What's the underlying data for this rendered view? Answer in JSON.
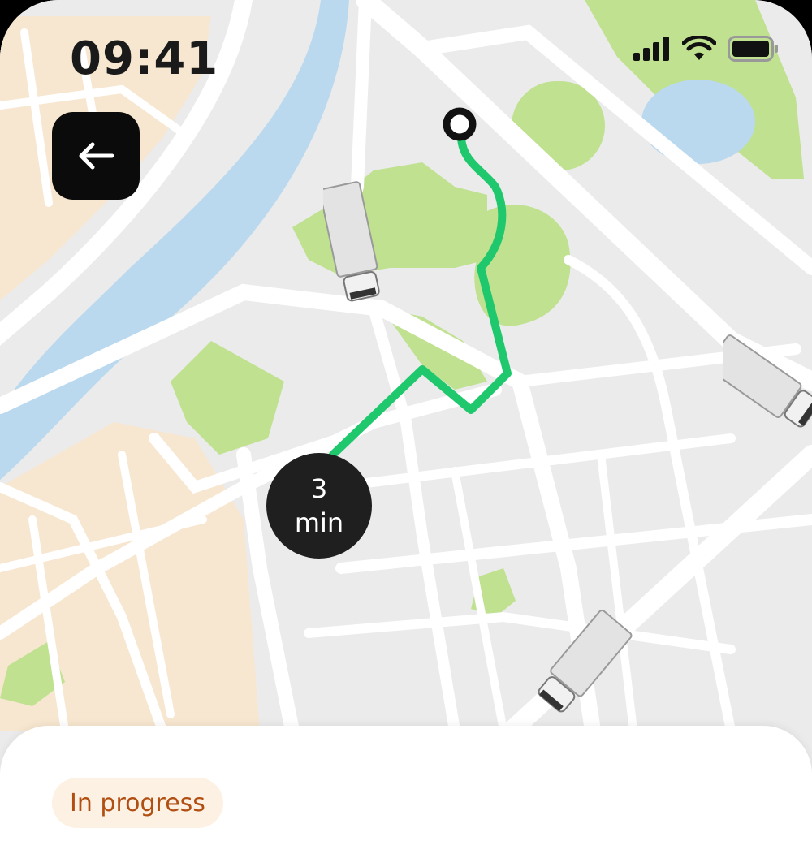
{
  "status_bar": {
    "time": "09:41",
    "icons": [
      "cellular-signal-icon",
      "wifi-icon",
      "battery-icon"
    ]
  },
  "navigation": {
    "back_icon": "arrow-left-icon"
  },
  "map": {
    "eta_value": "3",
    "eta_unit": "min",
    "route_color": "#1fc86d",
    "colors": {
      "land": "#ebebeb",
      "road": "#ffffff",
      "water": "#bad9ef",
      "park": "#bfe190",
      "built": "#f7e7d0"
    }
  },
  "sheet": {
    "status_label": "In progress",
    "status_color": "#b14f12",
    "status_bg": "#fdf1e3"
  }
}
